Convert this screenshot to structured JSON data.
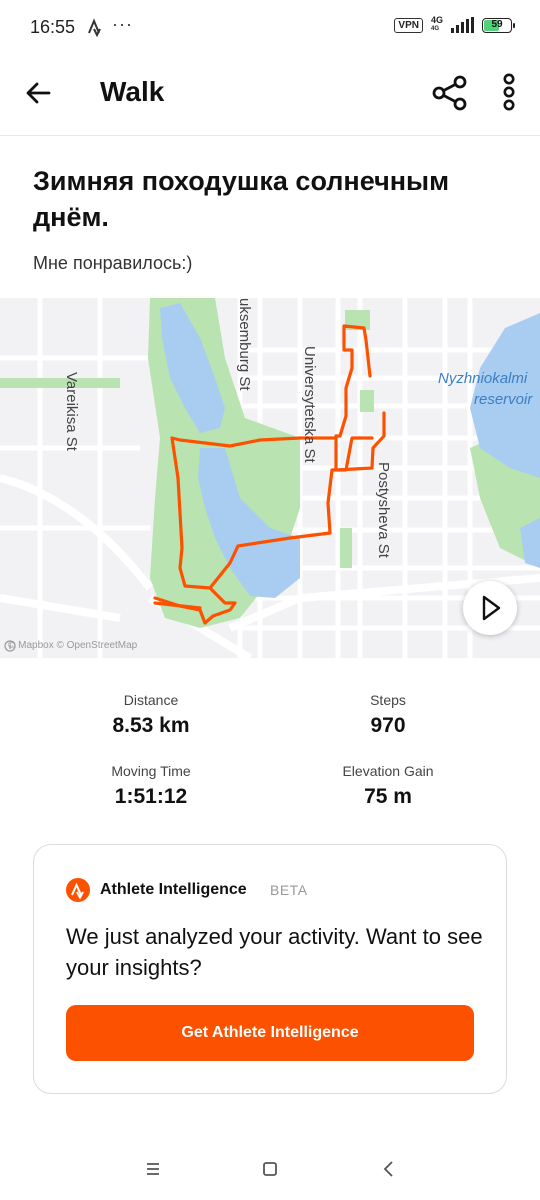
{
  "status_bar": {
    "time": "16:55",
    "dots": "···",
    "vpn": "VPN",
    "network_top": "4G",
    "network_bottom": "4G",
    "battery_percent": "59",
    "battery_level": 0.59,
    "icons": [
      "strava-activity-icon",
      "vpn-icon",
      "signal-icon",
      "battery-icon"
    ]
  },
  "app_bar": {
    "title": "Walk",
    "icons": [
      "back-arrow-icon",
      "share-icon",
      "more-vertical-icon"
    ]
  },
  "activity": {
    "title": "Зимняя походушка солнечным днём.",
    "description": "Мне понравилось:)"
  },
  "map": {
    "labels": {
      "luxemburg_st": "uksemburg St",
      "universytetska_st": "Universytetska St",
      "vareikisa_st": "Vareikisa St",
      "postysheva_st": "Postysheva St",
      "water_name_1": "Nyzhniokalmi",
      "water_name_2": "reservoir"
    },
    "attribution": "© Mapbox © OpenStreetMap",
    "route_color": "#fc5200",
    "water_color": "#a9cdf0",
    "park_color": "#b9e3b0"
  },
  "stats": [
    {
      "label": "Distance",
      "value": "8.53 km"
    },
    {
      "label": "Steps",
      "value": "970"
    },
    {
      "label": "Moving Time",
      "value": "1:51:12"
    },
    {
      "label": "Elevation Gain",
      "value": "75 m"
    }
  ],
  "athlete_intelligence": {
    "title": "Athlete Intelligence",
    "badge": "BETA",
    "message": "We just analyzed your activity. Want to see your insights?",
    "button_label": "Get Athlete Intelligence",
    "accent": "#fc5200"
  },
  "nav_bar": {
    "icons": [
      "menu-icon",
      "home-square-icon",
      "back-chevron-icon"
    ]
  }
}
